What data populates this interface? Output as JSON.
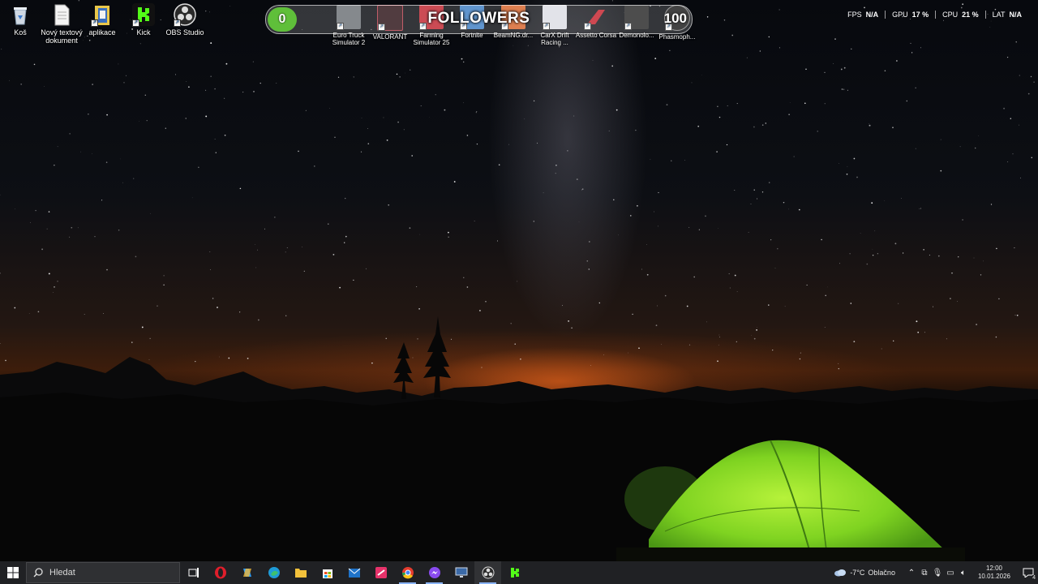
{
  "desktop": {
    "icons": [
      {
        "label": "Koš",
        "icon": "recycle-bin-icon"
      },
      {
        "label": "Nový textový dokument",
        "icon": "text-document-icon"
      },
      {
        "label": "aplikace",
        "icon": "folder-icon"
      },
      {
        "label": "Kick",
        "icon": "kick-icon"
      },
      {
        "label": "OBS Studio",
        "icon": "obs-icon"
      }
    ]
  },
  "follower_goal": {
    "title": "FOLLOWERS",
    "min": "0",
    "max": "100",
    "current": 0,
    "colors": {
      "fill": "#7ccf52",
      "start": "#5fbf3a"
    }
  },
  "games": [
    {
      "label": "Euro Truck Simulator 2",
      "icon": "euro-truck-icon"
    },
    {
      "label": "VALORANT",
      "icon": "valorant-icon"
    },
    {
      "label": "Farming Simulator 25",
      "icon": "farming-sim-icon"
    },
    {
      "label": "Fortnite",
      "icon": "fortnite-icon"
    },
    {
      "label": "BeamNG.dr...",
      "icon": "beamng-icon"
    },
    {
      "label": "CarX Drift Racing ...",
      "icon": "carx-icon"
    },
    {
      "label": "Assetto Corsa",
      "icon": "assetto-corsa-icon"
    },
    {
      "label": "Demonolo...",
      "icon": "demonologist-icon"
    },
    {
      "label": "Phasmoph...",
      "icon": "phasmophobia-icon"
    }
  ],
  "performance": [
    {
      "label": "FPS",
      "value": "N/A"
    },
    {
      "label": "GPU",
      "value": "17 %"
    },
    {
      "label": "CPU",
      "value": "21 %"
    },
    {
      "label": "LAT",
      "value": "N/A"
    }
  ],
  "taskbar": {
    "search_placeholder": "Hledat",
    "apps": [
      "task-view-icon",
      "opera-icon",
      "copilot-icon",
      "edge-icon",
      "file-explorer-icon",
      "store-icon",
      "mail-icon",
      "streamer-app-icon",
      "chrome-icon",
      "messenger-icon",
      "monitor-app-icon",
      "obs-icon",
      "kick-icon"
    ],
    "weather": {
      "temp": "-7°C",
      "condition": "Oblačno",
      "icon": "cloud-icon"
    },
    "clock": {
      "time": "12:00",
      "date": "10.01.2026"
    },
    "notifications": "4"
  }
}
